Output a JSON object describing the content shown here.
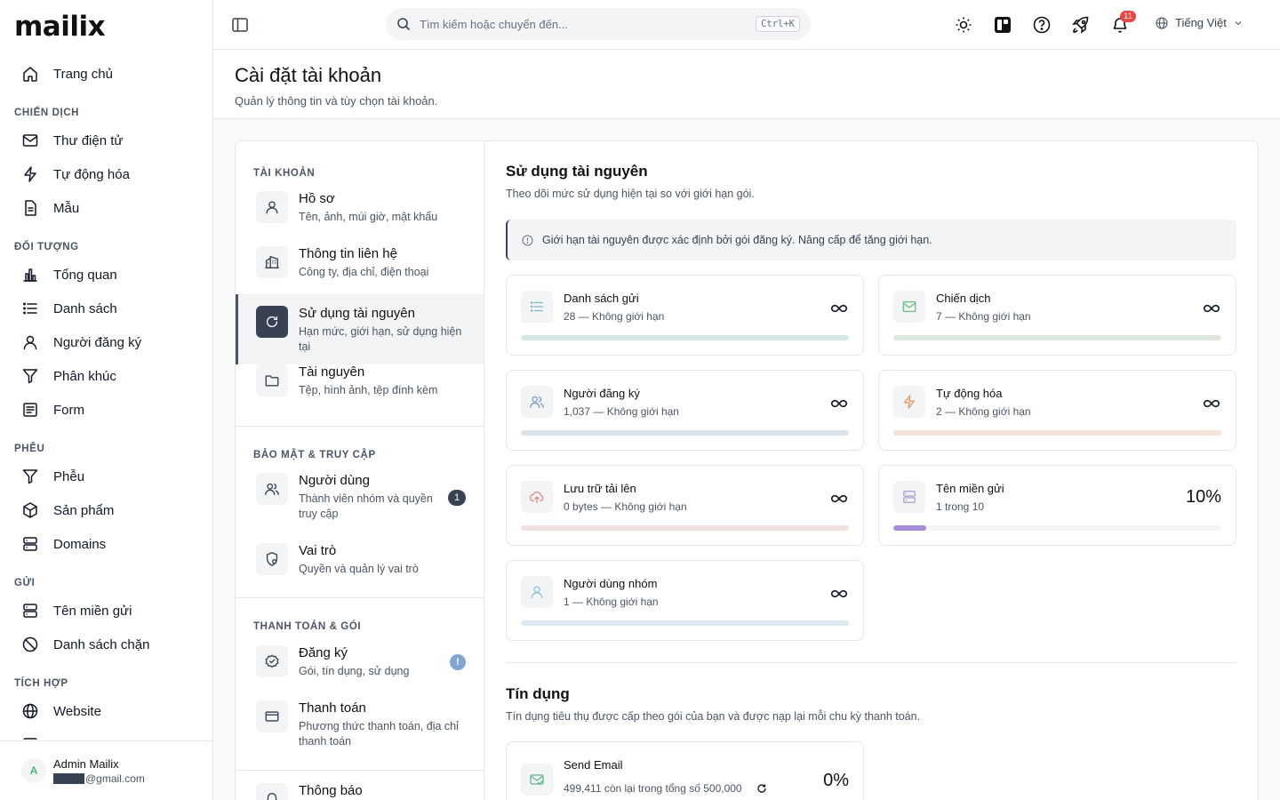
{
  "app": {
    "logo": "mailix"
  },
  "sidebar": {
    "items": [
      {
        "type": "item",
        "icon": "home-icon",
        "label": "Trang chủ"
      },
      {
        "type": "section",
        "label": "CHIẾN DỊCH"
      },
      {
        "type": "item",
        "icon": "mail-icon",
        "label": "Thư điện tử"
      },
      {
        "type": "item",
        "icon": "zap-icon",
        "label": "Tự động hóa"
      },
      {
        "type": "item",
        "icon": "file-icon",
        "label": "Mẫu"
      },
      {
        "type": "section",
        "label": "ĐỐI TƯỢNG"
      },
      {
        "type": "item",
        "icon": "bar-chart-icon",
        "label": "Tổng quan"
      },
      {
        "type": "item",
        "icon": "list-icon",
        "label": "Danh sách"
      },
      {
        "type": "item",
        "icon": "user-icon",
        "label": "Người đăng ký"
      },
      {
        "type": "item",
        "icon": "filter-icon",
        "label": "Phân khúc"
      },
      {
        "type": "item",
        "icon": "form-icon",
        "label": "Form"
      },
      {
        "type": "section",
        "label": "PHỄU"
      },
      {
        "type": "item",
        "icon": "funnel-icon",
        "label": "Phễu"
      },
      {
        "type": "item",
        "icon": "box-icon",
        "label": "Sản phẩm"
      },
      {
        "type": "item",
        "icon": "server-icon",
        "label": "Domains"
      },
      {
        "type": "section",
        "label": "GỬI"
      },
      {
        "type": "item",
        "icon": "server-icon",
        "label": "Tên miền gửi"
      },
      {
        "type": "item",
        "icon": "ban-icon",
        "label": "Danh sách chặn"
      },
      {
        "type": "section",
        "label": "TÍCH HỢP"
      },
      {
        "type": "item",
        "icon": "globe-icon",
        "label": "Website"
      },
      {
        "type": "item",
        "icon": "server-icon",
        "label": ""
      }
    ],
    "user": {
      "initial": "A",
      "name": "Admin Mailix",
      "email_suffix": "@gmail.com"
    }
  },
  "topbar": {
    "search_placeholder": "Tìm kiếm hoặc chuyển đến...",
    "shortcut": "Ctrl+K",
    "notifications_count": "11",
    "language": "Tiếng Việt"
  },
  "header": {
    "title": "Cài đặt tài khoản",
    "subtitle": "Quản lý thông tin và tùy chọn tài khoản."
  },
  "settings_nav": {
    "sections": [
      "TÀI KHOẢN",
      "BẢO MẬT & TRUY CẬP",
      "THANH TOÁN & GÓI"
    ],
    "items": [
      {
        "title": "Hồ sơ",
        "desc": "Tên, ảnh, múi giờ, mật khẩu",
        "icon": "user-icon"
      },
      {
        "title": "Thông tin liên hệ",
        "desc": "Công ty, địa chỉ, điện thoại",
        "icon": "building-icon"
      },
      {
        "title": "Sử dụng tài nguyên",
        "desc": "Hạn mức, giới hạn, sử dụng hiện tại",
        "icon": "refresh-circle-icon",
        "active": true
      },
      {
        "title": "Tài nguyên",
        "desc": "Tệp, hình ảnh, tệp đính kèm",
        "icon": "folder-icon"
      },
      {
        "title": "Người dùng",
        "desc": "Thành viên nhóm và quyền truy cập",
        "icon": "users-icon",
        "badge": "1"
      },
      {
        "title": "Vai trò",
        "desc": "Quyền và quản lý vai trò",
        "icon": "shield-user-icon"
      },
      {
        "title": "Đăng ký",
        "desc": "Gói, tín dụng, sử dụng",
        "icon": "badge-check-icon",
        "badge": "!"
      },
      {
        "title": "Thanh toán",
        "desc": "Phương thức thanh toán, địa chỉ thanh toán",
        "icon": "credit-card-icon"
      },
      {
        "title": "Thông báo",
        "desc": "",
        "icon": "bell-icon"
      }
    ]
  },
  "resources": {
    "title": "Sử dụng tài nguyên",
    "subtitle": "Theo dõi mức sử dụng hiện tại so với giới hạn gói.",
    "info": "Giới hạn tài nguyên được xác định bởi gói đăng ký. Nâng cấp để tăng giới hạn.",
    "cards": [
      {
        "name": "Danh sách gửi",
        "value": "28 — Không giới hạn",
        "icon": "list-icon",
        "color": "#d7e6e6",
        "fill": 0,
        "unlimited": true
      },
      {
        "name": "Chiến dịch",
        "value": "7 — Không giới hạn",
        "icon": "mail-icon",
        "color": "#dbe9dd",
        "fill": 0,
        "unlimited": true
      },
      {
        "name": "Người đăng ký",
        "value": "1,037 — Không giới hạn",
        "icon": "users-icon",
        "color": "#dbe4ec",
        "fill": 0,
        "unlimited": true
      },
      {
        "name": "Tự động hóa",
        "value": "2 — Không giới hạn",
        "icon": "zap-icon",
        "color": "#f3e2d8",
        "fill": 0,
        "unlimited": true
      },
      {
        "name": "Lưu trữ tải lên",
        "value": "0 bytes — Không giới hạn",
        "icon": "cloud-upload-icon",
        "color": "#f1e0e0",
        "fill": 0,
        "unlimited": true
      },
      {
        "name": "Tên miền gửi",
        "value": "1 trong 10",
        "icon": "server-icon",
        "color": "#f3f4f6",
        "fill": 0.1,
        "fill_color": "#a78bdb",
        "pct": "10%"
      },
      {
        "name": "Người dùng nhóm",
        "value": "1 — Không giới hạn",
        "icon": "user-icon",
        "color": "#dce9ef",
        "fill": 0,
        "unlimited": true
      }
    ]
  },
  "credits": {
    "title": "Tín dụng",
    "subtitle": "Tín dụng tiêu thụ được cấp theo gói của bạn và được nạp lại mỗi chu kỳ thanh toán.",
    "card": {
      "name": "Send Email",
      "value": "499,411 còn lại trong tổng số 500,000",
      "pct": "0%"
    }
  }
}
